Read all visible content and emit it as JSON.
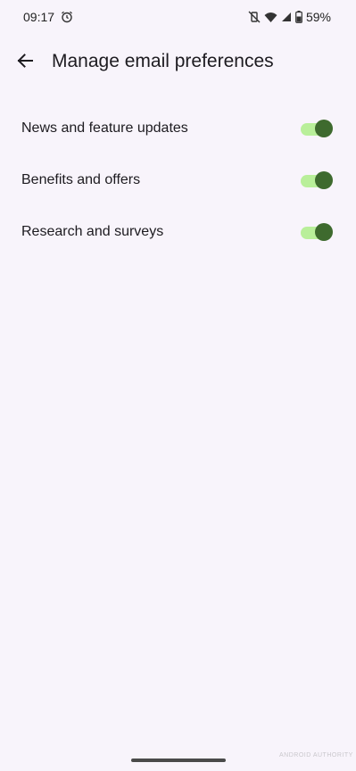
{
  "status_bar": {
    "time": "09:17",
    "battery_percent": "59%",
    "icons": [
      "alarm-icon",
      "mute-vibrate-icon",
      "wifi-icon",
      "signal-icon",
      "battery-icon"
    ]
  },
  "app_bar": {
    "back_icon": "arrow-left-icon",
    "title": "Manage email preferences"
  },
  "settings": [
    {
      "label": "News and feature updates",
      "enabled": true
    },
    {
      "label": "Benefits and offers",
      "enabled": true
    },
    {
      "label": "Research and surveys",
      "enabled": true
    }
  ],
  "colors": {
    "background": "#f8f4fb",
    "switch_track_on": "#b9ef9a",
    "switch_thumb_on": "#3e6a2e"
  },
  "watermark": "ANDROID AUTHORITY"
}
